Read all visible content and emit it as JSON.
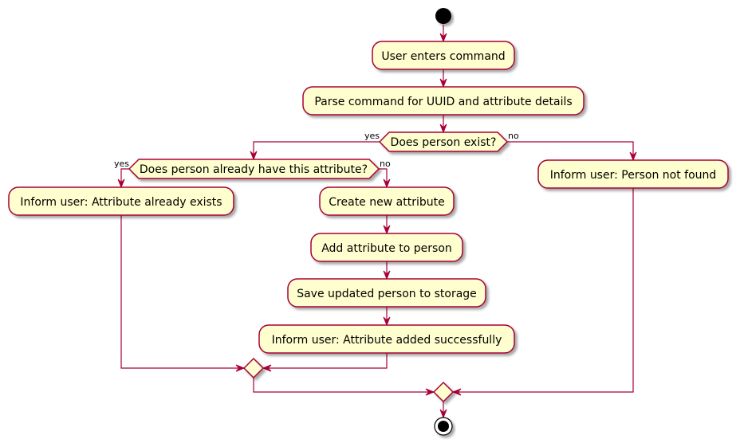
{
  "diagram": {
    "type": "activity",
    "colors": {
      "stroke": "#A80036",
      "fill": "#FEFECE",
      "shadow": "#c8c8c8",
      "node": "#000000"
    },
    "nodes": {
      "start": "start",
      "user_enters": "User enters command",
      "parse": "Parse command for UUID and attribute details",
      "decision_exist": "Does person exist?",
      "decision_attr": "Does person already have this attribute?",
      "inform_exists": "Inform user: Attribute already exists",
      "create_attr": "Create new attribute",
      "add_attr": "Add attribute to person",
      "save_person": "Save updated person to storage",
      "inform_added": "Inform user: Attribute added successfully",
      "inform_not_found": "Inform user: Person not found",
      "end": "end"
    },
    "branch_labels": {
      "exist_yes": "yes",
      "exist_no": "no",
      "attr_yes": "yes",
      "attr_no": "no"
    }
  }
}
